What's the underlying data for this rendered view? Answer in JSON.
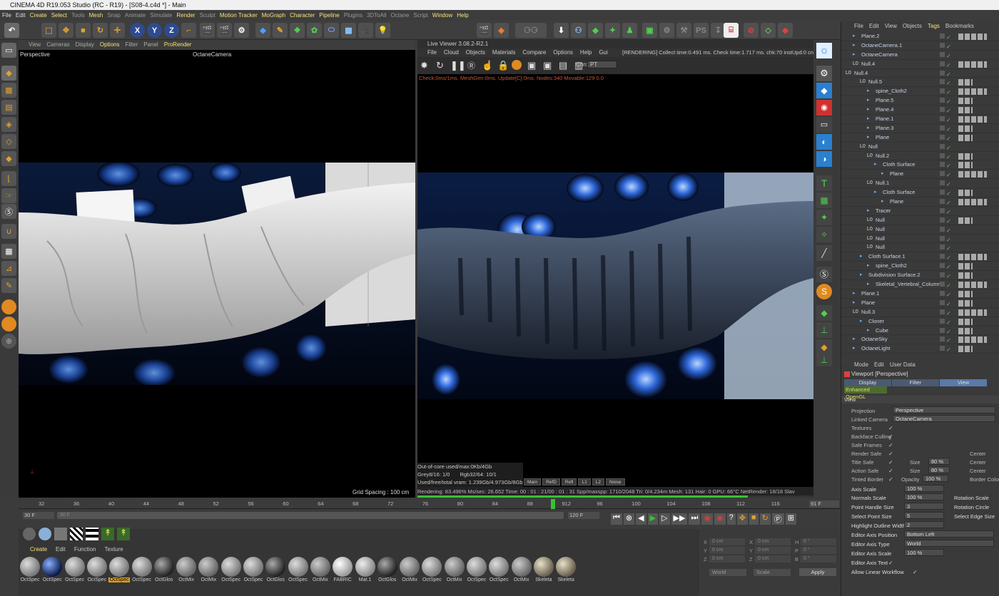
{
  "window": {
    "title": "CINEMA 4D R19.053 Studio (RC - R19) - [S08-4.c4d *] - Main"
  },
  "menu": [
    {
      "label": "File",
      "c": ""
    },
    {
      "label": "Edit",
      "c": ""
    },
    {
      "label": "Create",
      "c": "hl"
    },
    {
      "label": "Select",
      "c": "hl"
    },
    {
      "label": "Tools",
      "c": "dim"
    },
    {
      "label": "Mesh",
      "c": "hl"
    },
    {
      "label": "Snap",
      "c": "dim"
    },
    {
      "label": "Animate",
      "c": "dim"
    },
    {
      "label": "Simulate",
      "c": "dim"
    },
    {
      "label": "Render",
      "c": "hl"
    },
    {
      "label": "Sculpt",
      "c": "dim"
    },
    {
      "label": "Motion Tracker",
      "c": "hl"
    },
    {
      "label": "MoGraph",
      "c": "hl"
    },
    {
      "label": "Character",
      "c": "hl"
    },
    {
      "label": "Pipeline",
      "c": "hl"
    },
    {
      "label": "Plugins",
      "c": "dim"
    },
    {
      "label": "3DToAll",
      "c": "dim"
    },
    {
      "label": "Octane",
      "c": "dim"
    },
    {
      "label": "Script",
      "c": "dim"
    },
    {
      "label": "Window",
      "c": "hl"
    },
    {
      "label": "Help",
      "c": "hl"
    }
  ],
  "toolbar": {
    "x": "X",
    "y": "Y",
    "z": "Z"
  },
  "viewport": {
    "menu": [
      "View",
      "Cameras",
      "Display",
      "Options",
      "Filter",
      "Panel",
      "ProRender"
    ],
    "name": "Perspective",
    "camera": "OctaneCamera",
    "grid": "Grid Spacing : 100 cm"
  },
  "liveviewer": {
    "title": "Live Viewer 3.08.2-R2.1",
    "menu": [
      "File",
      "Cloud",
      "Objects",
      "Materials",
      "Compare",
      "Options",
      "Help",
      "Gui"
    ],
    "status_top": "[RENDERING] Collect time:0.491 ms.  Check time:1.717 ms.  chk:70  instUpd:0  cnt",
    "chn_label": "Chn:",
    "chn_value": "PT",
    "debug": "Check:0ms/1ms. MeshGen:0ms. Update[C]:0ms. Nodes:340 Movable:129  0.0",
    "ooc": "Out-of-core used/max:0Kb/4Gb",
    "grey": "Grey8/16: 1/0",
    "rgb": "Rgb32/64: 10/1",
    "vram": "Used/free/total vram: 1.239Gb/4.973Gb/8Gb",
    "passes": [
      "Main",
      "RefD",
      "Refl",
      "L1",
      "L2",
      "Noise"
    ],
    "bottom": "Rendering: 83.496%  Ms/sec: 26.652   Time: 00 : 01 : 21/00 : 01 : 31    Spp/maxspp: 1710/2048   Tri: 0/4.234m   Mesh: 131   Hair: 0    GPU:  66°C    NetRender: 18/18    Slav"
  },
  "timeline": {
    "ticks": [
      "32",
      "36",
      "40",
      "44",
      "48",
      "52",
      "56",
      "60",
      "64",
      "68",
      "72",
      "76",
      "80",
      "84",
      "88",
      "912",
      "96",
      "100",
      "104",
      "108",
      "112",
      "116"
    ],
    "current": "91 F",
    "start": "30 F",
    "end": "120 F",
    "end2": "120 F",
    "frame_a": "30 F"
  },
  "materials": {
    "menu": [
      "Create",
      "Edit",
      "Function",
      "Texture"
    ],
    "items": [
      "OctSpec",
      "OctSpec",
      "OctSpec",
      "OctSpec",
      "OctSpec",
      "OctSpec",
      "OctGlos",
      "OctMix",
      "OctMix",
      "OctSpec",
      "OctSpec",
      "OctGlos",
      "OctSpec",
      "OctMix",
      "FABRIC",
      "Mat.1",
      "OctGlos",
      "OctMix",
      "OctSpec",
      "OctMix",
      "OctSpec",
      "OctSpec",
      "OctMix",
      "Skeleta",
      "Skeleta"
    ]
  },
  "coords": {
    "rows": [
      [
        "X",
        "0 cm",
        "X",
        "0 cm",
        "H",
        "0 °"
      ],
      [
        "Y",
        "0 cm",
        "Y",
        "0 cm",
        "P",
        "0 °"
      ],
      [
        "Z",
        "0 cm",
        "Z",
        "0 cm",
        "B",
        "0 °"
      ]
    ],
    "world": "World",
    "scale": "Scale",
    "apply": "Apply"
  },
  "objmgr": {
    "menu": [
      "File",
      "Edit",
      "View",
      "Objects",
      "Tags",
      "Bookmarks"
    ],
    "rows": [
      {
        "n": "Plane.2",
        "d": 1
      },
      {
        "n": "OctaneCamera.1",
        "d": 1
      },
      {
        "n": "OctaneCamera",
        "d": 1
      },
      {
        "n": "Null.4",
        "d": 1
      },
      {
        "n": "Null.4",
        "d": 0
      },
      {
        "n": "Null.5",
        "d": 2
      },
      {
        "n": "spine_Cloth2",
        "d": 3
      },
      {
        "n": "Plane.5",
        "d": 3
      },
      {
        "n": "Plane.4",
        "d": 3
      },
      {
        "n": "Plane.1",
        "d": 3
      },
      {
        "n": "Plane.3",
        "d": 3
      },
      {
        "n": "Plane",
        "d": 3
      },
      {
        "n": "Null",
        "d": 2
      },
      {
        "n": "Null.2",
        "d": 3
      },
      {
        "n": "Cloth Surface",
        "d": 4
      },
      {
        "n": "Plane",
        "d": 5
      },
      {
        "n": "Null.1",
        "d": 3
      },
      {
        "n": "Cloth Surface",
        "d": 4
      },
      {
        "n": "Plane",
        "d": 5
      },
      {
        "n": "Tracer",
        "d": 3
      },
      {
        "n": "Null",
        "d": 3
      },
      {
        "n": "Null",
        "d": 3
      },
      {
        "n": "Null",
        "d": 3
      },
      {
        "n": "Null",
        "d": 3
      },
      {
        "n": "Cloth Surface.1",
        "d": 2
      },
      {
        "n": "spine_Cloth2",
        "d": 3
      },
      {
        "n": "Subdivision Surface.2",
        "d": 2
      },
      {
        "n": "Skeletal_Vertebral_Column",
        "d": 3
      },
      {
        "n": "Plane.1",
        "d": 1
      },
      {
        "n": "Plane",
        "d": 1
      },
      {
        "n": "Null.3",
        "d": 1
      },
      {
        "n": "Cloner",
        "d": 2
      },
      {
        "n": "Cube",
        "d": 3
      },
      {
        "n": "OctaneSky",
        "d": 1
      },
      {
        "n": "OctaneLight",
        "d": 1
      }
    ]
  },
  "attr": {
    "menu": [
      "Mode",
      "Edit",
      "User Data"
    ],
    "title": "Viewport [Perspective]",
    "tabs": [
      "Display",
      "Filter",
      "View"
    ],
    "tab2": "Enhanced OpenGL",
    "section": "View",
    "projection_l": "Projection",
    "projection_v": "Perspective",
    "linked_l": "Linked Camera",
    "linked_v": "OctaneCamera",
    "labels": [
      "Textures",
      "Backface Culling",
      "Safe Frames",
      "Render Safe",
      "Title Safe",
      "Action Safe",
      "Tinted Border",
      "Axis Scale",
      "Normals Scale",
      "Point Handle Size",
      "Select Point Size",
      "Highlight Outline Width",
      "Editor Axis Position",
      "Editor Axis Type",
      "Editor Axis Scale",
      "Editor Axis Text",
      "Allow Linear Workflow"
    ],
    "size": "Size",
    "center": "Center",
    "opacity": "Opacity",
    "opacity_v": "100 %",
    "size_v1": "80 %",
    "size_v2": "80 %",
    "border_col": "Border Color",
    "axis_scale": "100 %",
    "normals": "100 %",
    "point_handle": "3",
    "select_point": "5",
    "highlight": "2",
    "axis_pos": "Bottom Left",
    "axis_type": "World",
    "axis_scale2": "100 %",
    "rot_scale": "Rotation Scale",
    "rot_circle": "Rotation Circle",
    "sel_edge": "Select Edge Size"
  }
}
